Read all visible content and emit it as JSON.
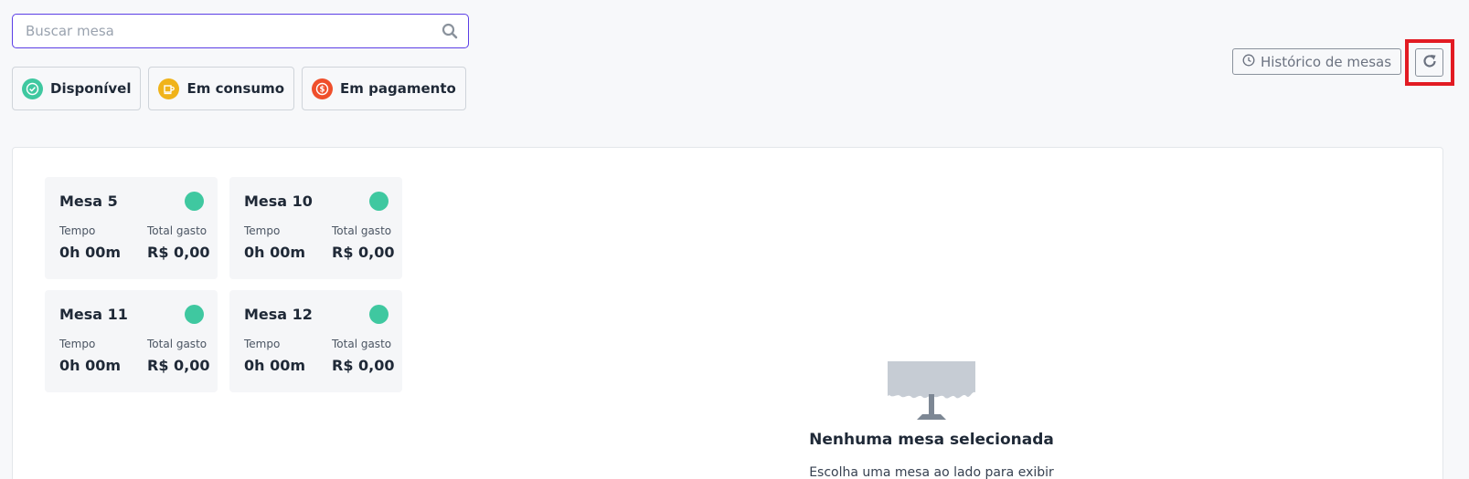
{
  "search": {
    "placeholder": "Buscar mesa",
    "value": "",
    "icon": "search-icon"
  },
  "filters": [
    {
      "label": "Disponível",
      "color": "#3fc8a0",
      "icon": "check-circle-icon"
    },
    {
      "label": "Em consumo",
      "color": "#f0b31a",
      "icon": "coffee-cup-icon"
    },
    {
      "label": "Em pagamento",
      "color": "#ef4f2b",
      "icon": "dollar-icon"
    }
  ],
  "header": {
    "history_label": "Histórico de mesas",
    "history_icon": "clock-icon",
    "refresh_icon": "refresh-icon",
    "highlight_color": "#e21b23"
  },
  "tables": [
    {
      "name": "Mesa 5",
      "time_label": "Tempo",
      "time": "0h 00m",
      "spent_label": "Total gasto",
      "spent": "R$ 0,00",
      "status_color": "#3fc8a0"
    },
    {
      "name": "Mesa 10",
      "time_label": "Tempo",
      "time": "0h 00m",
      "spent_label": "Total gasto",
      "spent": "R$ 0,00",
      "status_color": "#3fc8a0"
    },
    {
      "name": "Mesa 11",
      "time_label": "Tempo",
      "time": "0h 00m",
      "spent_label": "Total gasto",
      "spent": "R$ 0,00",
      "status_color": "#3fc8a0"
    },
    {
      "name": "Mesa 12",
      "time_label": "Tempo",
      "time": "0h 00m",
      "spent_label": "Total gasto",
      "spent": "R$ 0,00",
      "status_color": "#3fc8a0"
    }
  ],
  "empty_state": {
    "icon": "table-illustration-icon",
    "title": "Nenhuma mesa selecionada",
    "subtitle": "Escolha uma mesa ao lado para exibir"
  },
  "colors": {
    "accent": "#5b3ee6",
    "available": "#3fc8a0",
    "consuming": "#f0b31a",
    "paying": "#ef4f2b"
  }
}
